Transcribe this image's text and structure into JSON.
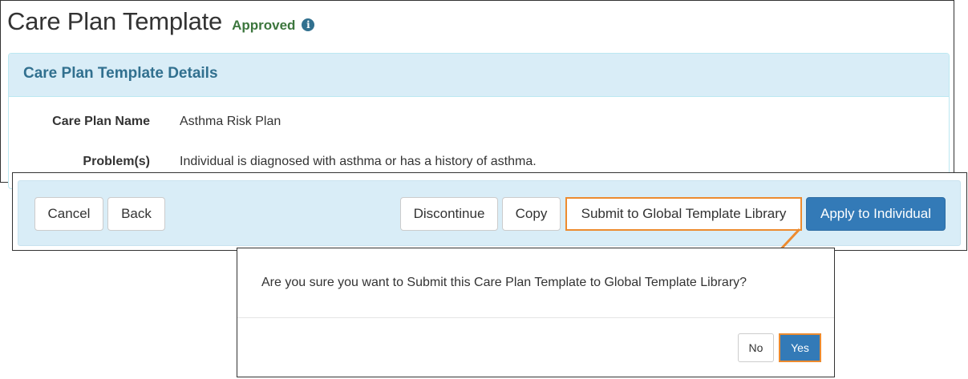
{
  "header": {
    "title": "Care Plan Template",
    "status": "Approved",
    "info_icon": "info-circle-icon"
  },
  "panel": {
    "title": "Care Plan Template Details",
    "fields": [
      {
        "label": "Care Plan Name",
        "value": "Asthma Risk Plan"
      },
      {
        "label": "Problem(s)",
        "value": "Individual is diagnosed with asthma or has a history of asthma."
      }
    ]
  },
  "actions": {
    "cancel": "Cancel",
    "back": "Back",
    "discontinue": "Discontinue",
    "copy": "Copy",
    "submit": "Submit to Global Template Library",
    "apply": "Apply to Individual"
  },
  "dialog": {
    "message": "Are you sure you want to Submit this Care Plan Template to Global Template Library?",
    "no": "No",
    "yes": "Yes"
  },
  "colors": {
    "approved": "#3c763d",
    "panel_heading_bg": "#d9edf7",
    "panel_title": "#31708f",
    "primary_button": "#337ab7",
    "highlight_outline": "#ed8b2f"
  }
}
